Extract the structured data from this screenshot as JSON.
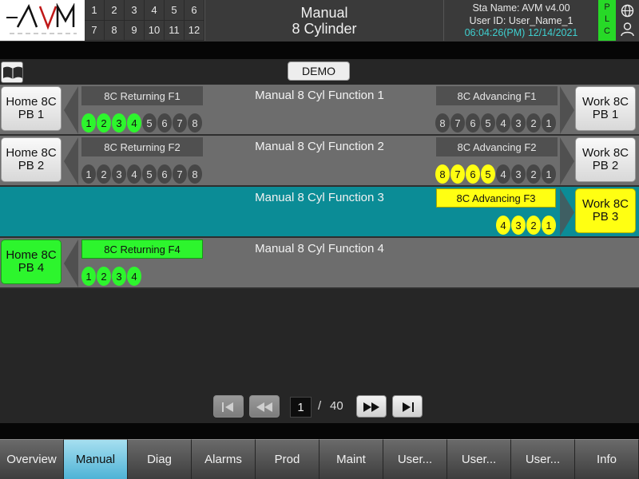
{
  "header": {
    "logo_text": "AVM",
    "stations_row1": [
      "1",
      "2",
      "3",
      "4",
      "5",
      "6"
    ],
    "stations_row2": [
      "7",
      "8",
      "9",
      "10",
      "11",
      "12"
    ],
    "title_line1": "Manual",
    "title_line2": "8 Cylinder",
    "sta_name": "Sta Name: AVM v4.00",
    "user_id": "User ID: User_Name_1",
    "datetime": "06:04:26(PM) 12/14/2021",
    "plc": [
      "P",
      "L",
      "C"
    ]
  },
  "demo_label": "DEMO",
  "rows": [
    {
      "home_pb": "Home 8C\nPB 1",
      "title": "Manual 8 Cyl Function 1",
      "ret_label": "8C Returning F1",
      "adv_label": "8C Advancing F1",
      "ret_dots": [
        "1",
        "2",
        "3",
        "4",
        "5",
        "6",
        "7",
        "8"
      ],
      "adv_dots": [
        "8",
        "7",
        "6",
        "5",
        "4",
        "3",
        "2",
        "1"
      ],
      "work_pb": "Work 8C\nPB 1"
    },
    {
      "home_pb": "Home 8C\nPB 2",
      "title": "Manual 8 Cyl Function 2",
      "ret_label": "8C Returning F2",
      "adv_label": "8C Advancing F2",
      "ret_dots": [
        "1",
        "2",
        "3",
        "4",
        "5",
        "6",
        "7",
        "8"
      ],
      "adv_dots": [
        "8",
        "7",
        "6",
        "5",
        "4",
        "3",
        "2",
        "1"
      ],
      "work_pb": "Work 8C\nPB 2"
    },
    {
      "title": "Manual 8 Cyl Function 3",
      "adv_label": "8C Advancing F3",
      "adv_dots": [
        "4",
        "3",
        "2",
        "1"
      ],
      "work_pb": "Work 8C\nPB 3"
    },
    {
      "home_pb": "Home 8C\nPB 4",
      "title": "Manual 8 Cyl Function 4",
      "ret_label": "8C Returning F4",
      "ret_dots": [
        "1",
        "2",
        "3",
        "4"
      ]
    }
  ],
  "pagination": {
    "current": "1",
    "separator": "/",
    "total": "40"
  },
  "nav_tabs": [
    "Overview",
    "Manual",
    "Diag",
    "Alarms",
    "Prod",
    "Maint",
    "User...",
    "User...",
    "User...",
    "Info"
  ],
  "colors": {
    "green": "#2df52d",
    "yellow": "#ffff12",
    "teal": "#0b8c96",
    "active_tab": "#4fb3d6"
  }
}
